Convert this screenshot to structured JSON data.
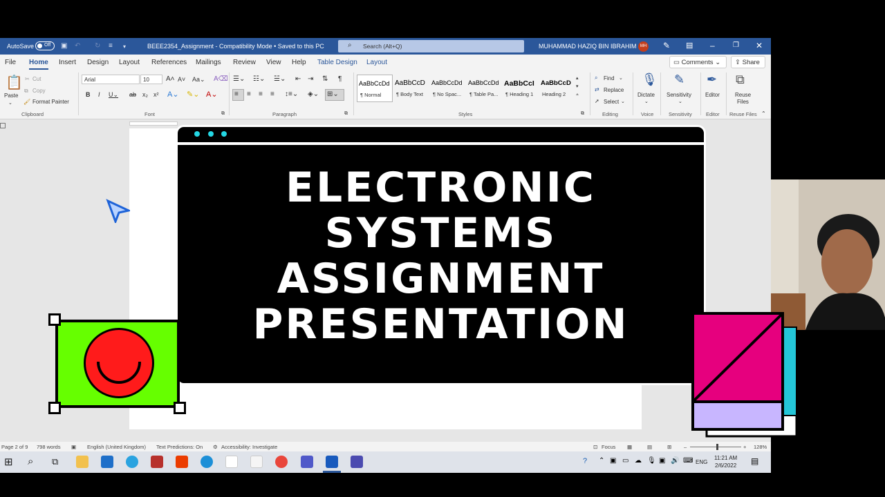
{
  "titlebar": {
    "autosave_label": "AutoSave",
    "autosave_state": "Off",
    "document_title": "BEEE2354_Assignment  -  Compatibility Mode • Saved to this PC",
    "search_placeholder": "Search (Alt+Q)",
    "user_name": "MUHAMMAD HAZIQ BIN IBRAHIM",
    "user_initials": "MH"
  },
  "tabs": {
    "items": [
      "File",
      "Home",
      "Insert",
      "Design",
      "Layout",
      "References",
      "Mailings",
      "Review",
      "View",
      "Help",
      "Table Design",
      "Layout"
    ],
    "comments": "Comments",
    "share": "Share"
  },
  "ribbon": {
    "clipboard": {
      "paste": "Paste",
      "cut": "Cut",
      "copy": "Copy",
      "format_painter": "Format Painter",
      "group": "Clipboard"
    },
    "font": {
      "name": "Arial",
      "size": "10",
      "group": "Font"
    },
    "paragraph": {
      "group": "Paragraph"
    },
    "styles": {
      "items": [
        {
          "preview": "AaBbCcDd",
          "name": "¶ Normal"
        },
        {
          "preview": "AaBbCcD",
          "name": "¶ Body Text"
        },
        {
          "preview": "AaBbCcDd",
          "name": "¶ No Spac..."
        },
        {
          "preview": "AaBbCcDd",
          "name": "¶ Table Pa..."
        },
        {
          "preview": "AaBbCcI",
          "name": "¶ Heading 1"
        },
        {
          "preview": "AaBbCcD",
          "name": "Heading 2"
        }
      ],
      "group": "Styles"
    },
    "editing": {
      "find": "Find",
      "replace": "Replace",
      "select": "Select",
      "group": "Editing"
    },
    "voice": {
      "dictate": "Dictate",
      "group": "Voice"
    },
    "sensitivity": {
      "label": "Sensitivity",
      "group": "Sensitivity"
    },
    "editor": {
      "label": "Editor",
      "group": "Editor"
    },
    "reuse": {
      "label1": "Reuse",
      "label2": "Files",
      "group": "Reuse Files"
    }
  },
  "slide": {
    "title_lines": [
      "ELECTRONIC",
      "SYSTEMS",
      "ASSIGNMENT",
      "PRESENTATION"
    ]
  },
  "statusbar": {
    "page": "Page 2 of 9",
    "words": "798 words",
    "language": "English (United Kingdom)",
    "predictions": "Text Predictions: On",
    "accessibility": "Accessibility: Investigate",
    "focus": "Focus",
    "zoom": "128%"
  },
  "taskbar": {
    "language": "ENG",
    "time": "11:21 AM",
    "date": "2/6/2022"
  },
  "colors": {
    "word_blue": "#2b579a",
    "sticker_green": "#66ff00",
    "face_red": "#ff1b1b",
    "accent_cyan": "#24d7e4",
    "accent_pink": "#e6007e",
    "accent_lavender": "#c8b6ff"
  }
}
